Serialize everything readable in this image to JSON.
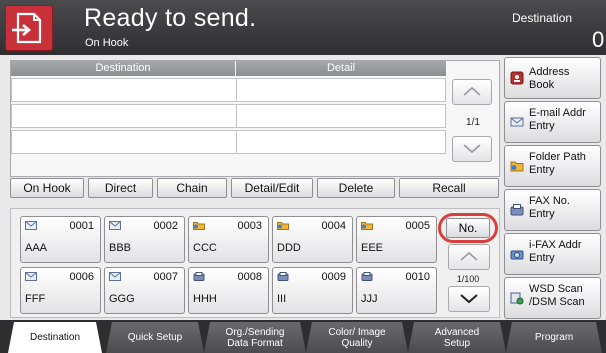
{
  "header": {
    "title": "Ready to send.",
    "subtitle": "On Hook",
    "destination_label": "Destination",
    "destination_count": "0"
  },
  "list": {
    "columns": [
      "Destination",
      "Detail"
    ],
    "page": "1/1"
  },
  "actions": [
    "On Hook",
    "Direct",
    "Chain",
    "Detail/Edit",
    "Delete",
    "Recall"
  ],
  "keys": [
    {
      "num": "0001",
      "name": "AAA",
      "icon": "email-icon"
    },
    {
      "num": "0002",
      "name": "BBB",
      "icon": "email-icon"
    },
    {
      "num": "0003",
      "name": "CCC",
      "icon": "folder-icon"
    },
    {
      "num": "0004",
      "name": "DDD",
      "icon": "folder-icon"
    },
    {
      "num": "0005",
      "name": "EEE",
      "icon": "folder-icon"
    },
    {
      "num": "0006",
      "name": "FFF",
      "icon": "email-icon"
    },
    {
      "num": "0007",
      "name": "GGG",
      "icon": "email-icon"
    },
    {
      "num": "0008",
      "name": "HHH",
      "icon": "fax-icon"
    },
    {
      "num": "0009",
      "name": "III",
      "icon": "fax-icon"
    },
    {
      "num": "0010",
      "name": "JJJ",
      "icon": "fax-icon"
    }
  ],
  "number_button": "No.",
  "grid_page": "1/100",
  "side_panel": [
    {
      "label": "Address Book",
      "icon": "address-book-icon"
    },
    {
      "label": "E-mail Addr Entry",
      "icon": "email-icon"
    },
    {
      "label": "Folder Path Entry",
      "icon": "folder-icon"
    },
    {
      "label": "FAX No. Entry",
      "icon": "fax-icon"
    },
    {
      "label": "i-FAX Addr Entry",
      "icon": "ifax-icon"
    },
    {
      "label": "WSD Scan /DSM Scan",
      "icon": "wsd-scan-icon"
    }
  ],
  "tabs": [
    "Destination",
    "Quick Setup",
    "Org./Sending Data Format",
    "Color/ Image Quality",
    "Advanced Setup",
    "Program"
  ],
  "colors": {
    "header_bg": "#3a3a3c",
    "send_icon_bg": "#c8313a",
    "highlight_ring": "#d9403c"
  }
}
